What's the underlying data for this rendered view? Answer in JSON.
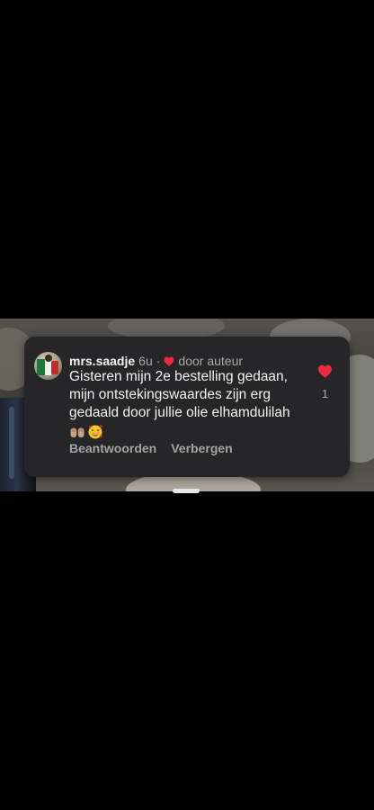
{
  "comment": {
    "username": "mrs.saadje",
    "timestamp": "6u",
    "separator": "·",
    "author_badge": "door auteur",
    "text": "Gisteren mijn 2e bestelling gedaan, mijn ontstekingswaardes zijn erg gedaald door jullie olie elhamdulilah",
    "emojis": [
      "hands-icon",
      "smiling-face-with-hearts-icon"
    ],
    "like_count": "1",
    "liked": true,
    "actions": {
      "reply": "Beantwoorden",
      "hide": "Verbergen"
    }
  },
  "colors": {
    "card_background": "#262628",
    "heart": "#ed2a3f",
    "muted_text": "#a8a8a8"
  }
}
